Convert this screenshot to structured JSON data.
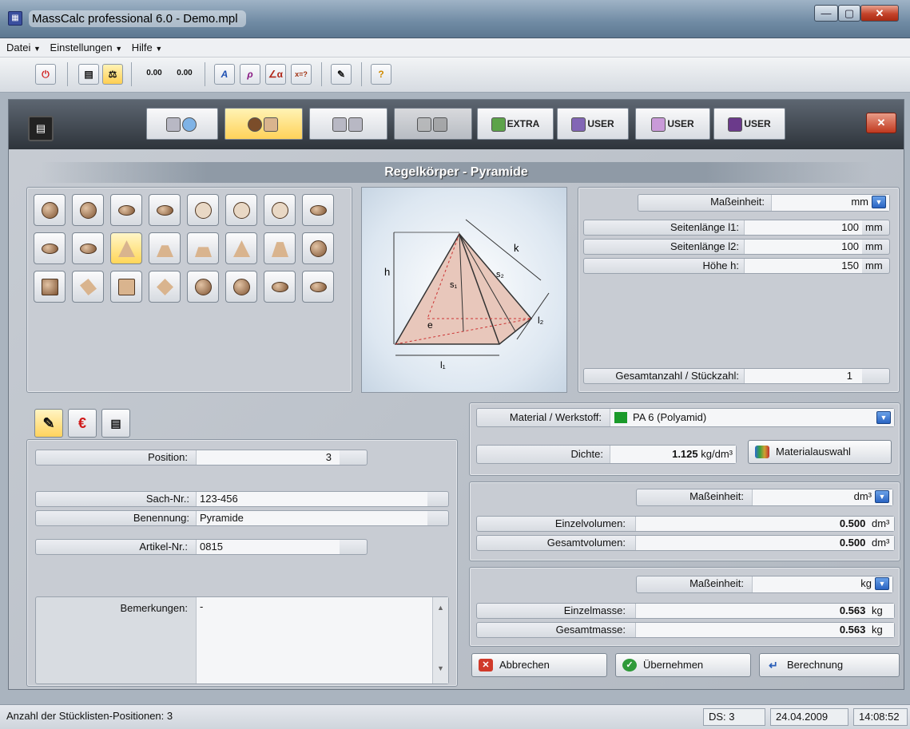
{
  "window": {
    "title": "MassCalc professional 6.0 - Demo.mpl",
    "min": "—",
    "max": "▢",
    "close": "✕"
  },
  "menu": [
    {
      "label": "Datei"
    },
    {
      "label": "Einstellungen"
    },
    {
      "label": "Hilfe"
    }
  ],
  "toolbar": {
    "value1": "0.00",
    "value2": "0.00"
  },
  "category_tabs": [
    {
      "label": "",
      "active": false
    },
    {
      "label": "",
      "active": true
    },
    {
      "label": "",
      "active": false
    },
    {
      "label": "",
      "active": false
    },
    {
      "label": "EXTRA",
      "active": false
    },
    {
      "label": "USER",
      "active": false
    },
    {
      "label": "USER",
      "active": false
    },
    {
      "label": "USER",
      "active": false
    }
  ],
  "section_title": "Regelkörper - Pyramide",
  "diagram": {
    "h": "h",
    "k": "k",
    "s1": "s₁",
    "s2": "s₂",
    "e": "e",
    "l1": "l₁",
    "l2": "l₂"
  },
  "dims": {
    "unit_label": "Maßeinheit:",
    "unit_value": "mm",
    "rows": [
      {
        "label": "Seitenlänge l1:",
        "value": "100",
        "unit": "mm"
      },
      {
        "label": "Seitenlänge l2:",
        "value": "100",
        "unit": "mm"
      },
      {
        "label": "Höhe h:",
        "value": "150",
        "unit": "mm"
      }
    ],
    "count_label": "Gesamtanzahl / Stückzahl:",
    "count_value": "1"
  },
  "info": {
    "position_label": "Position:",
    "position_value": "3",
    "sach_label": "Sach-Nr.:",
    "sach_value": "123-456",
    "benennung_label": "Benennung:",
    "benennung_value": "Pyramide",
    "artikel_label": "Artikel-Nr.:",
    "artikel_value": "0815",
    "bemerkungen_label": "Bemerkungen:",
    "bemerkungen_value": "-"
  },
  "material": {
    "label": "Material / Werkstoff:",
    "value": "PA 6 (Polyamid)",
    "color": "#1a9a2a",
    "dichte_label": "Dichte:",
    "dichte_value": "1.125",
    "dichte_unit": "kg/dm³",
    "button": "Materialauswahl"
  },
  "volume": {
    "unit_label": "Maßeinheit:",
    "unit_value": "dm³",
    "einzel_label": "Einzelvolumen:",
    "einzel_value": "0.500",
    "einzel_unit": "dm³",
    "gesamt_label": "Gesamtvolumen:",
    "gesamt_value": "0.500",
    "gesamt_unit": "dm³"
  },
  "mass": {
    "unit_label": "Maßeinheit:",
    "unit_value": "kg",
    "einzel_label": "Einzelmasse:",
    "einzel_value": "0.563",
    "einzel_unit": "kg",
    "gesamt_label": "Gesamtmasse:",
    "gesamt_value": "0.563",
    "gesamt_unit": "kg"
  },
  "actions": {
    "cancel": "Abbrechen",
    "apply": "Übernehmen",
    "calc": "Berechnung"
  },
  "status": {
    "positions": "Anzahl der Stücklisten-Positionen: 3",
    "ds": "DS: 3",
    "date": "24.04.2009",
    "time": "14:08:52"
  }
}
